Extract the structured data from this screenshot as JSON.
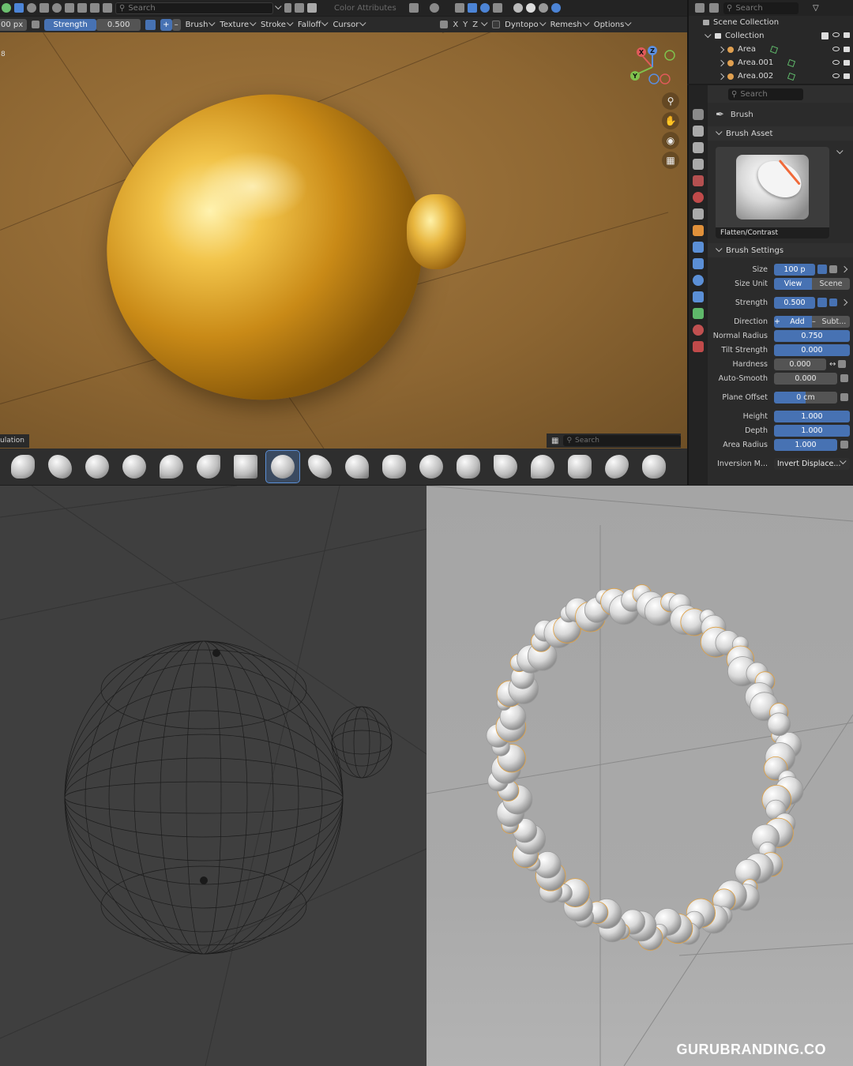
{
  "header": {
    "search_placeholder": "Search",
    "color_attributes": "Color Attributes"
  },
  "tool": {
    "radius_value": "00 px",
    "strength_label": "Strength",
    "strength_value": "0.500",
    "menus": [
      "Brush",
      "Texture",
      "Stroke",
      "Falloff",
      "Cursor"
    ],
    "axes": [
      "X",
      "Y",
      "Z"
    ],
    "dyntopo": "Dyntopo",
    "remesh": "Remesh",
    "options": "Options"
  },
  "viewport": {
    "corner_label": "8",
    "mode_label": "ulation",
    "asset_search_placeholder": "Search",
    "gizmo": {
      "x": "X",
      "y": "Y",
      "z": "Z"
    }
  },
  "shelf": {
    "brushes": [
      "draw-icon",
      "draw-sharp-icon",
      "clay-icon",
      "clay-strips-icon",
      "blob-icon",
      "crease-icon",
      "pinch-icon",
      "flatten-contrast-icon",
      "scrape-icon",
      "fill-icon",
      "layer-icon",
      "inflate-icon",
      "smooth-icon",
      "grab-icon",
      "snake-hook-icon",
      "thumb-icon",
      "elastic-icon",
      "pose-icon"
    ],
    "active_index": 7
  },
  "outliner": {
    "search_placeholder": "Search",
    "scene_collection": "Scene Collection",
    "collection": "Collection",
    "items": [
      "Area",
      "Area.001",
      "Area.002"
    ]
  },
  "properties": {
    "search_placeholder": "Search",
    "brush_label": "Brush",
    "brush_asset_title": "Brush Asset",
    "brush_name": "Flatten/Contrast",
    "brush_settings_title": "Brush Settings",
    "size": {
      "label": "Size",
      "value": "100 p"
    },
    "size_unit": {
      "label": "Size Unit",
      "options": [
        "View",
        "Scene"
      ],
      "selected": "View"
    },
    "strength": {
      "label": "Strength",
      "value": "0.500"
    },
    "direction": {
      "label": "Direction",
      "options": [
        "Add",
        "Subt..."
      ],
      "selected": "Add"
    },
    "normal_radius": {
      "label": "Normal Radius",
      "value": "0.750"
    },
    "tilt_strength": {
      "label": "Tilt Strength",
      "value": "0.000"
    },
    "hardness": {
      "label": "Hardness",
      "value": "0.000"
    },
    "auto_smooth": {
      "label": "Auto-Smooth",
      "value": "0.000"
    },
    "plane_offset": {
      "label": "Plane Offset",
      "value": "0 cm"
    },
    "height": {
      "label": "Height",
      "value": "1.000"
    },
    "depth": {
      "label": "Depth",
      "value": "1.000"
    },
    "area_radius": {
      "label": "Area Radius",
      "value": "1.000"
    },
    "inversion_mode": {
      "label": "Inversion M...",
      "value": "Invert Displace..."
    }
  },
  "watermark": "GURUBRANDING.CO",
  "colors": {
    "accent": "#4772b3",
    "gold": "#d9a22a",
    "bg": "#2b2b2b"
  }
}
